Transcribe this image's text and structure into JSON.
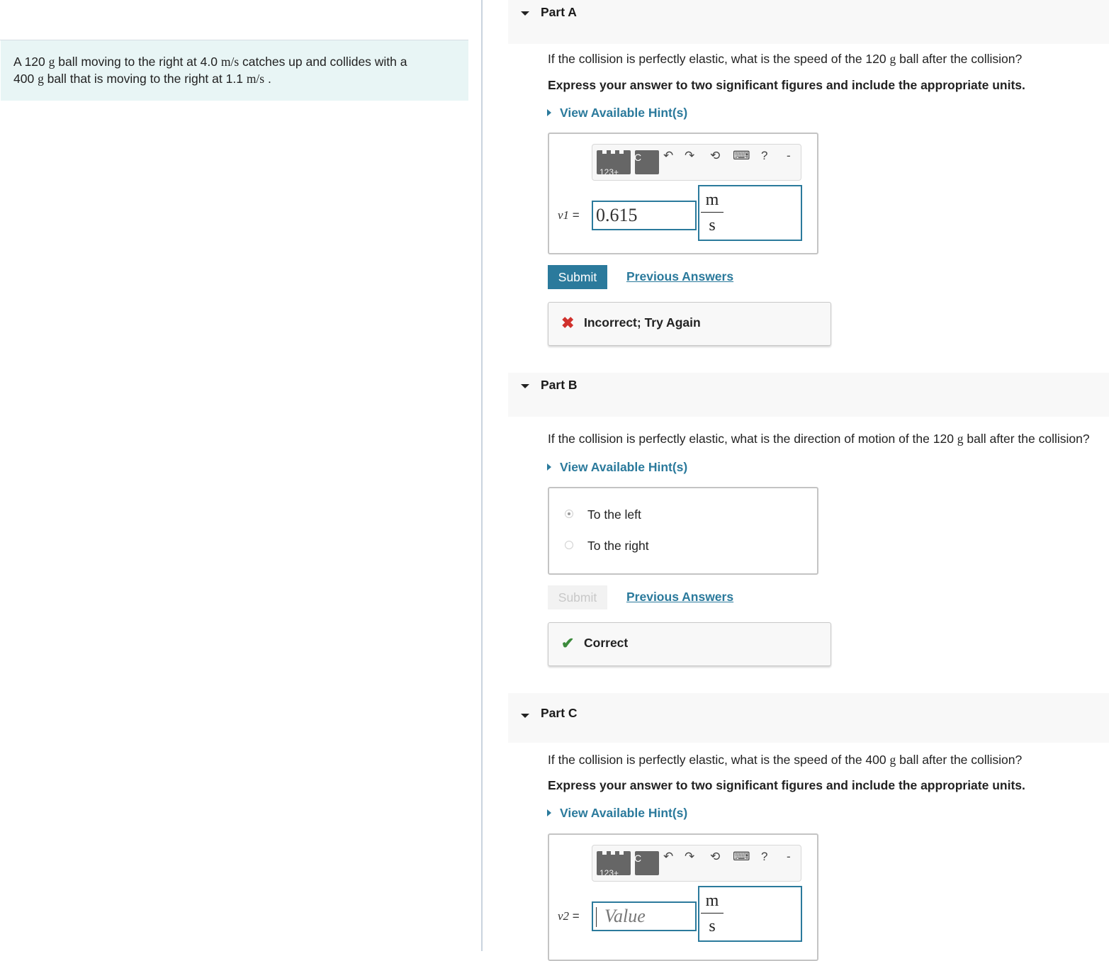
{
  "problem": {
    "segments": [
      {
        "t": "A 120 "
      },
      {
        "m": "g"
      },
      {
        "t": " ball moving to the right at 4.0 "
      },
      {
        "m": "m/s"
      },
      {
        "t": "  catches up and collides with a"
      },
      {
        "br": true
      },
      {
        "t": "400 "
      },
      {
        "m": "g"
      },
      {
        "t": " ball that is moving to the right at 1.1 "
      },
      {
        "m": "m/s"
      },
      {
        "t": " ."
      }
    ]
  },
  "toolbar": {
    "btn_123": "123+",
    "btn_c": "C",
    "undo_icon": "↶",
    "redo_icon": "↷",
    "reset_icon": "⟲",
    "keyboard_icon": "⌨",
    "help_icon": "?",
    "more_icon": "-"
  },
  "parts": {
    "a": {
      "title": "Part A",
      "question_pre": "If the collision is perfectly elastic, what is the speed of the 120 ",
      "question_unit": "g",
      "question_post": " ball after the collision?",
      "instruction": "Express your answer to two significant figures and include the appropriate units.",
      "hint_label": "View Available Hint(s)",
      "variable": "v1",
      "equals": "=",
      "value": "0.615",
      "unit_numerator": "m",
      "unit_denominator": "s",
      "submit_label": "Submit",
      "previous_answers_label": "Previous Answers",
      "feedback_icon": "✖",
      "feedback_text": "Incorrect; Try Again",
      "feedback_color": "#d0312d"
    },
    "b": {
      "title": "Part B",
      "question_pre": "If the collision is perfectly elastic, what is the direction of motion of the 120 ",
      "question_unit": "g",
      "question_post": " ball after the collision?",
      "hint_label": "View Available Hint(s)",
      "options": [
        {
          "label": "To the left",
          "selected": true
        },
        {
          "label": "To the right",
          "selected": false
        }
      ],
      "submit_label": "Submit",
      "previous_answers_label": "Previous Answers",
      "feedback_icon": "✔",
      "feedback_text": "Correct",
      "feedback_color": "#3c8a3c"
    },
    "c": {
      "title": "Part C",
      "question_pre": "If the collision is perfectly elastic, what is the speed of the 400 ",
      "question_unit": "g",
      "question_post": " ball after the collision?",
      "instruction": "Express your answer to two significant figures and include the appropriate units.",
      "hint_label": "View Available Hint(s)",
      "variable": "v2",
      "equals": "=",
      "value_placeholder": "Value",
      "unit_numerator": "m",
      "unit_denominator": "s"
    }
  }
}
